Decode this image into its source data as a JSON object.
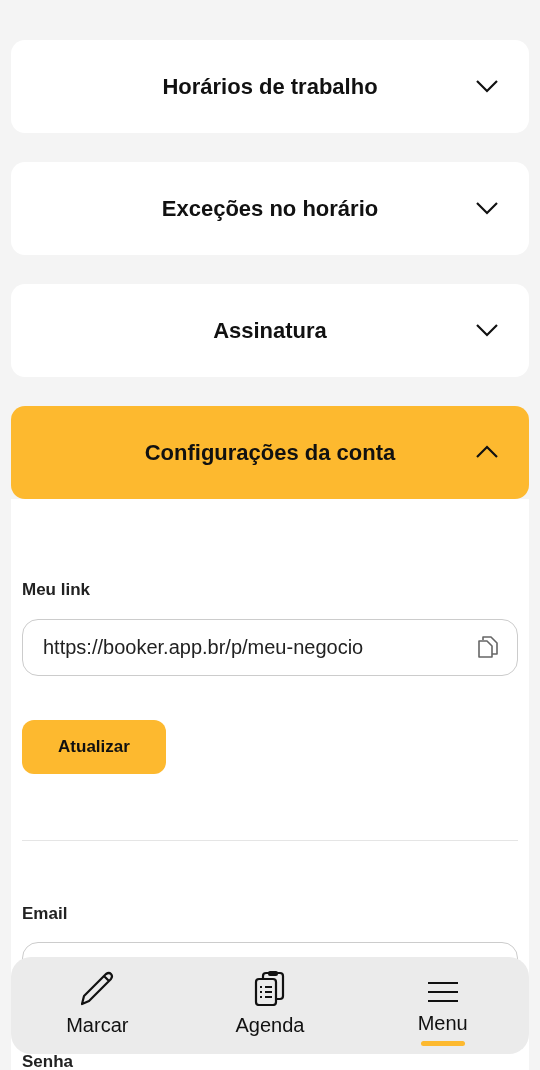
{
  "sections": [
    {
      "title": "Horários de trabalho",
      "expanded": false
    },
    {
      "title": "Exceções no horário",
      "expanded": false
    },
    {
      "title": "Assinatura",
      "expanded": false
    },
    {
      "title": "Configurações da conta",
      "expanded": true
    }
  ],
  "account": {
    "link_label": "Meu link",
    "link_value": "https://booker.app.br/p/meu-negocio",
    "update_button": "Atualizar",
    "email_label": "Email",
    "password_label": "Senha"
  },
  "bottom_nav": [
    {
      "label": "Marcar",
      "kind": "pencil",
      "selected": false
    },
    {
      "label": "Agenda",
      "kind": "clipboard",
      "selected": false
    },
    {
      "label": "Menu",
      "kind": "menu",
      "selected": true
    }
  ]
}
